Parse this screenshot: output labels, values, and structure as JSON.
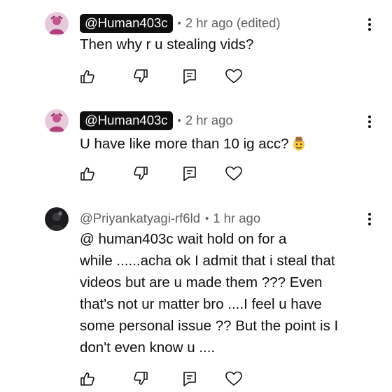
{
  "comments": [
    {
      "author": "@Human403c",
      "author_style": "pill",
      "time": "2 hr ago (edited)",
      "lines": [
        "Then why r u stealing vids?"
      ]
    },
    {
      "author": "@Human403c",
      "author_style": "pill",
      "time": "2 hr ago",
      "lines": [
        "U have like more than 10 ig acc?"
      ],
      "emoji": "cowboy-face"
    },
    {
      "author": "@Priyankatyagi-rf6ld",
      "author_style": "plain",
      "time": "1 hr ago",
      "lines": [
        "@ human403c wait hold on for a",
        "while ......acha ok I admit that i steal that",
        "videos but are u made them ??? Even",
        "that's not ur matter bro ....I feel u have",
        "some personal issue ?? But the point is I",
        "don't even know u ...."
      ]
    }
  ],
  "separator": "•",
  "icons": [
    "like-icon",
    "dislike-icon",
    "reply-icon",
    "heart-icon",
    "more-options-icon"
  ],
  "colors": {
    "text": "#0f0f0f",
    "meta": "#606060",
    "pill_bg": "#0f0f0f",
    "pill_text": "#ffffff",
    "icon": "#0f0f0f"
  }
}
